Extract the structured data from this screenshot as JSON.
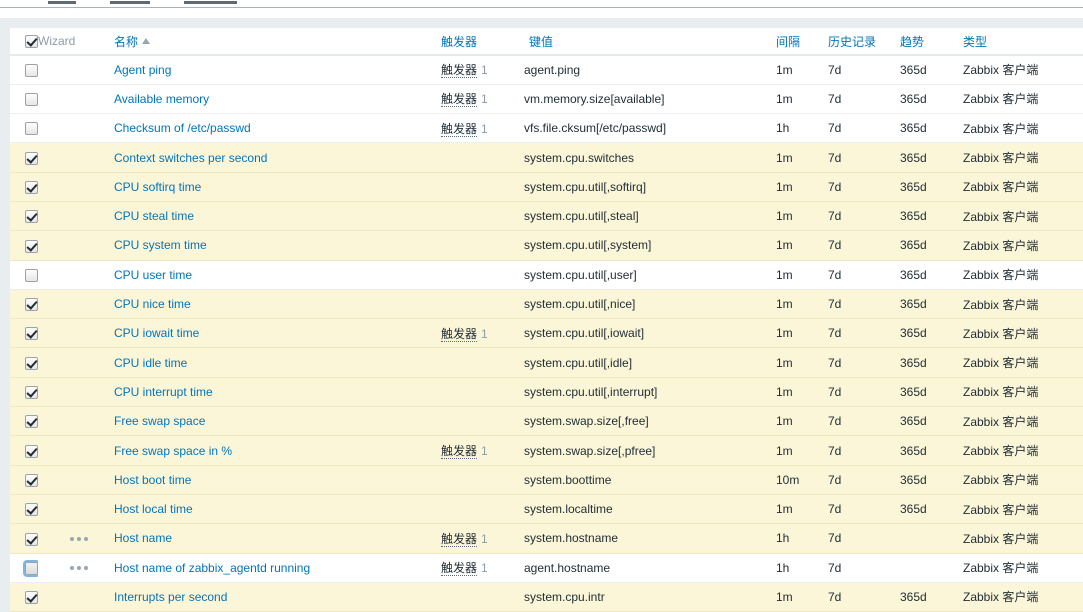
{
  "table": {
    "columns": [
      {
        "key": "checkbox",
        "label": "",
        "type": "checkbox"
      },
      {
        "key": "wizard",
        "label": "Wizard",
        "link": false
      },
      {
        "key": "name",
        "label": "名称",
        "link": true,
        "sorted": "asc",
        "sort_indicator": "▲"
      },
      {
        "key": "triggers",
        "label": "触发器",
        "link": true
      },
      {
        "key": "key",
        "label": "键值",
        "link": true
      },
      {
        "key": "interval",
        "label": "间隔",
        "link": true
      },
      {
        "key": "history",
        "label": "历史记录",
        "link": true
      },
      {
        "key": "trends",
        "label": "趋势",
        "link": true
      },
      {
        "key": "type",
        "label": "类型",
        "link": true
      }
    ],
    "select_all_checked": true,
    "trigger_label": "触发器",
    "rows": [
      {
        "checked": false,
        "focused": false,
        "wizard": false,
        "name": "Agent ping",
        "trigger_count": "1",
        "key": "agent.ping",
        "interval": "1m",
        "history": "7d",
        "trends": "365d",
        "type": "Zabbix 客户端",
        "highlight": false
      },
      {
        "checked": false,
        "focused": false,
        "wizard": false,
        "name": "Available memory",
        "trigger_count": "1",
        "key": "vm.memory.size[available]",
        "interval": "1m",
        "history": "7d",
        "trends": "365d",
        "type": "Zabbix 客户端",
        "highlight": false
      },
      {
        "checked": false,
        "focused": false,
        "wizard": false,
        "name": "Checksum of /etc/passwd",
        "trigger_count": "1",
        "key": "vfs.file.cksum[/etc/passwd]",
        "interval": "1h",
        "history": "7d",
        "trends": "365d",
        "type": "Zabbix 客户端",
        "highlight": false
      },
      {
        "checked": true,
        "focused": false,
        "wizard": false,
        "name": "Context switches per second",
        "trigger_count": "",
        "key": "system.cpu.switches",
        "interval": "1m",
        "history": "7d",
        "trends": "365d",
        "type": "Zabbix 客户端",
        "highlight": true
      },
      {
        "checked": true,
        "focused": false,
        "wizard": false,
        "name": "CPU softirq time",
        "trigger_count": "",
        "key": "system.cpu.util[,softirq]",
        "interval": "1m",
        "history": "7d",
        "trends": "365d",
        "type": "Zabbix 客户端",
        "highlight": true
      },
      {
        "checked": true,
        "focused": false,
        "wizard": false,
        "name": "CPU steal time",
        "trigger_count": "",
        "key": "system.cpu.util[,steal]",
        "interval": "1m",
        "history": "7d",
        "trends": "365d",
        "type": "Zabbix 客户端",
        "highlight": true
      },
      {
        "checked": true,
        "focused": false,
        "wizard": false,
        "name": "CPU system time",
        "trigger_count": "",
        "key": "system.cpu.util[,system]",
        "interval": "1m",
        "history": "7d",
        "trends": "365d",
        "type": "Zabbix 客户端",
        "highlight": true
      },
      {
        "checked": false,
        "focused": false,
        "wizard": false,
        "name": "CPU user time",
        "trigger_count": "",
        "key": "system.cpu.util[,user]",
        "interval": "1m",
        "history": "7d",
        "trends": "365d",
        "type": "Zabbix 客户端",
        "highlight": false
      },
      {
        "checked": true,
        "focused": false,
        "wizard": false,
        "name": "CPU nice time",
        "trigger_count": "",
        "key": "system.cpu.util[,nice]",
        "interval": "1m",
        "history": "7d",
        "trends": "365d",
        "type": "Zabbix 客户端",
        "highlight": true
      },
      {
        "checked": true,
        "focused": false,
        "wizard": false,
        "name": "CPU iowait time",
        "trigger_count": "1",
        "key": "system.cpu.util[,iowait]",
        "interval": "1m",
        "history": "7d",
        "trends": "365d",
        "type": "Zabbix 客户端",
        "highlight": true
      },
      {
        "checked": true,
        "focused": false,
        "wizard": false,
        "name": "CPU idle time",
        "trigger_count": "",
        "key": "system.cpu.util[,idle]",
        "interval": "1m",
        "history": "7d",
        "trends": "365d",
        "type": "Zabbix 客户端",
        "highlight": true
      },
      {
        "checked": true,
        "focused": false,
        "wizard": false,
        "name": "CPU interrupt time",
        "trigger_count": "",
        "key": "system.cpu.util[,interrupt]",
        "interval": "1m",
        "history": "7d",
        "trends": "365d",
        "type": "Zabbix 客户端",
        "highlight": true
      },
      {
        "checked": true,
        "focused": false,
        "wizard": false,
        "name": "Free swap space",
        "trigger_count": "",
        "key": "system.swap.size[,free]",
        "interval": "1m",
        "history": "7d",
        "trends": "365d",
        "type": "Zabbix 客户端",
        "highlight": true
      },
      {
        "checked": true,
        "focused": false,
        "wizard": false,
        "name": "Free swap space in %",
        "trigger_count": "1",
        "key": "system.swap.size[,pfree]",
        "interval": "1m",
        "history": "7d",
        "trends": "365d",
        "type": "Zabbix 客户端",
        "highlight": true
      },
      {
        "checked": true,
        "focused": false,
        "wizard": false,
        "name": "Host boot time",
        "trigger_count": "",
        "key": "system.boottime",
        "interval": "10m",
        "history": "7d",
        "trends": "365d",
        "type": "Zabbix 客户端",
        "highlight": true
      },
      {
        "checked": true,
        "focused": false,
        "wizard": false,
        "name": "Host local time",
        "trigger_count": "",
        "key": "system.localtime",
        "interval": "1m",
        "history": "7d",
        "trends": "365d",
        "type": "Zabbix 客户端",
        "highlight": true
      },
      {
        "checked": true,
        "focused": false,
        "wizard": true,
        "name": "Host name",
        "trigger_count": "1",
        "key": "system.hostname",
        "interval": "1h",
        "history": "7d",
        "trends": "",
        "type": "Zabbix 客户端",
        "highlight": true
      },
      {
        "checked": false,
        "focused": true,
        "wizard": true,
        "name": "Host name of zabbix_agentd running",
        "trigger_count": "1",
        "key": "agent.hostname",
        "interval": "1h",
        "history": "7d",
        "trends": "",
        "type": "Zabbix 客户端",
        "highlight": false
      },
      {
        "checked": true,
        "focused": false,
        "wizard": false,
        "name": "Interrupts per second",
        "trigger_count": "",
        "key": "system.cpu.intr",
        "interval": "1m",
        "history": "7d",
        "trends": "365d",
        "type": "Zabbix 客户端",
        "highlight": true
      }
    ]
  },
  "colors": {
    "link": "#0275b8",
    "highlight_row": "#fcf6d9",
    "page_bg": "#e8edf0",
    "text": "#1f2c33",
    "muted": "#8d9ca8"
  }
}
